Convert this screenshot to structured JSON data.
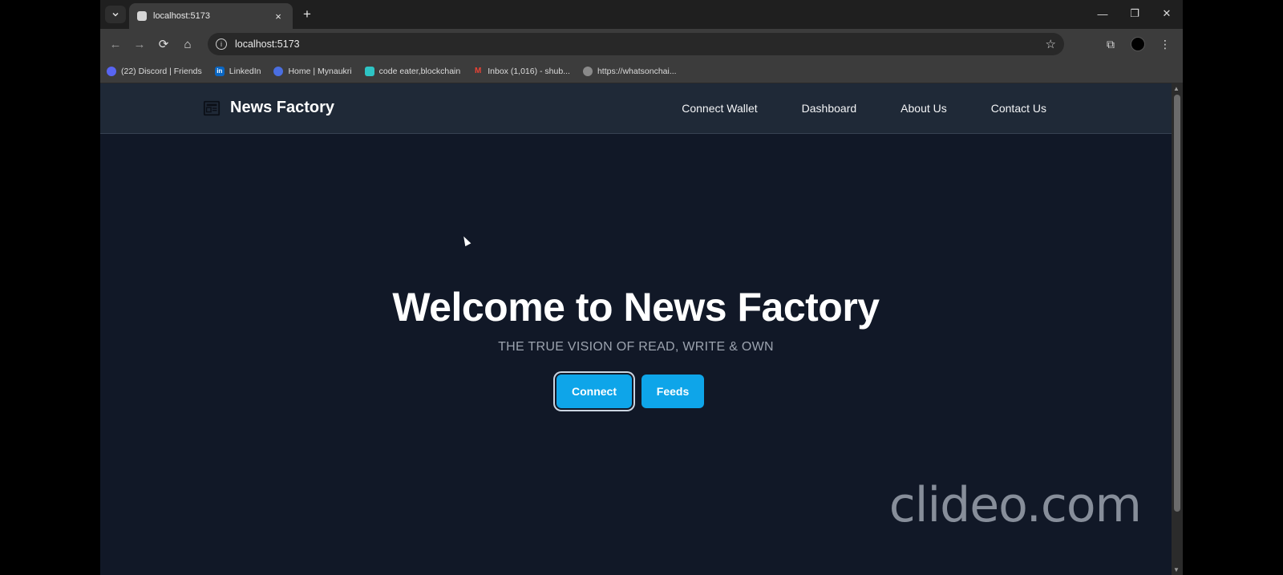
{
  "browser": {
    "tab": {
      "title": "localhost:5173",
      "close": "×"
    },
    "new_tab": "+",
    "window": {
      "minimize": "—",
      "restore": "❐",
      "close": "✕"
    },
    "toolbar": {
      "back": "←",
      "forward": "→",
      "reload": "⟳",
      "home": "⌂",
      "url": "localhost:5173",
      "star": "☆",
      "extensions": "⧉",
      "menu": "⋮"
    },
    "bookmarks": [
      {
        "label": "(22) Discord | Friends",
        "icon": "discord-icon",
        "color": "#5865f2"
      },
      {
        "label": "LinkedIn",
        "icon": "linkedin-icon",
        "color": "#0a66c2"
      },
      {
        "label": "Home | Mynaukri",
        "icon": "naukri-icon",
        "color": "#4a6ee0"
      },
      {
        "label": "code eater,blockchain",
        "icon": "code-eater-icon",
        "color": "#2ec4c4"
      },
      {
        "label": "Inbox (1,016) - shub...",
        "icon": "gmail-icon",
        "color": "#ea4335"
      },
      {
        "label": "https://whatsonchai...",
        "icon": "globe-icon",
        "color": "#8a8a8a"
      }
    ]
  },
  "site": {
    "brand": "News Factory",
    "nav": [
      "Connect Wallet",
      "Dashboard",
      "About Us",
      "Contact Us"
    ],
    "hero": {
      "title": "Welcome to News Factory",
      "subtitle": "THE TRUE VISION OF READ, WRITE & OWN",
      "connect_label": "Connect",
      "feeds_label": "Feeds"
    },
    "accent": "#0ea5e9",
    "background": "#111827",
    "nav_background": "#1f2937"
  },
  "watermark": "clideo.com"
}
